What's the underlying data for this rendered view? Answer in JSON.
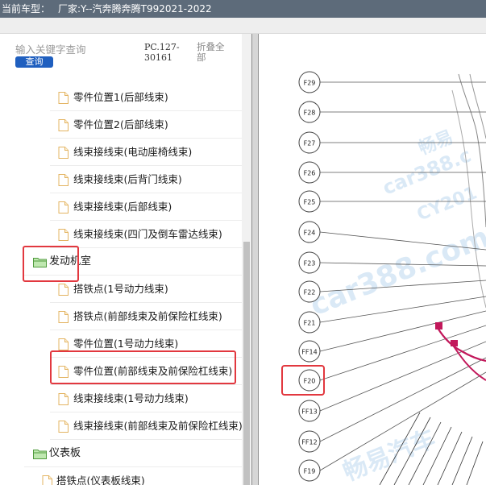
{
  "title": {
    "label": "当前车型：",
    "vehicle": "厂家:Y--汽奔腾奔腾T992021-2022"
  },
  "sidebar": {
    "search_placeholder": "输入关键字查询",
    "search_button": "查询",
    "code": "PC.127-30161",
    "collapse_all": "折叠全部",
    "items": [
      {
        "label": "零件位置1(后部线束)",
        "type": "file"
      },
      {
        "label": "零件位置2(后部线束)",
        "type": "file"
      },
      {
        "label": "线束接线束(电动座椅线束)",
        "type": "file"
      },
      {
        "label": "线束接线束(后背门线束)",
        "type": "file"
      },
      {
        "label": "线束接线束(后部线束)",
        "type": "file"
      },
      {
        "label": "线束接线束(四门及倒车雷达线束)",
        "type": "file"
      },
      {
        "label": "发动机室",
        "type": "folder"
      },
      {
        "label": "搭铁点(1号动力线束)",
        "type": "file"
      },
      {
        "label": "搭铁点(前部线束及前保险杠线束)",
        "type": "file"
      },
      {
        "label": "零件位置(1号动力线束)",
        "type": "file"
      },
      {
        "label": "零件位置(前部线束及前保险杠线束)",
        "type": "file",
        "highlighted": true
      },
      {
        "label": "线束接线束(1号动力线束)",
        "type": "file"
      },
      {
        "label": "线束接线束(前部线束及前保险杠线束)",
        "type": "file"
      },
      {
        "label": "仪表板",
        "type": "folder"
      },
      {
        "label": "搭铁点(仪表板线束)",
        "type": "file"
      }
    ]
  },
  "diagram": {
    "connectors": [
      "F29",
      "F28",
      "F27",
      "F26",
      "F25",
      "F24",
      "F23",
      "F22",
      "F21",
      "FF14",
      "F20",
      "FF13",
      "FF12",
      "F19"
    ],
    "highlighted_connector": "F20",
    "watermarks": [
      "畅易",
      "car388.c",
      "CY201",
      "car388.com",
      "畅易汽车"
    ]
  },
  "colors": {
    "highlight": "#e2383f",
    "titlebar": "#5d6b7a",
    "button": "#1f5fbf",
    "harness": "#c2185b"
  }
}
